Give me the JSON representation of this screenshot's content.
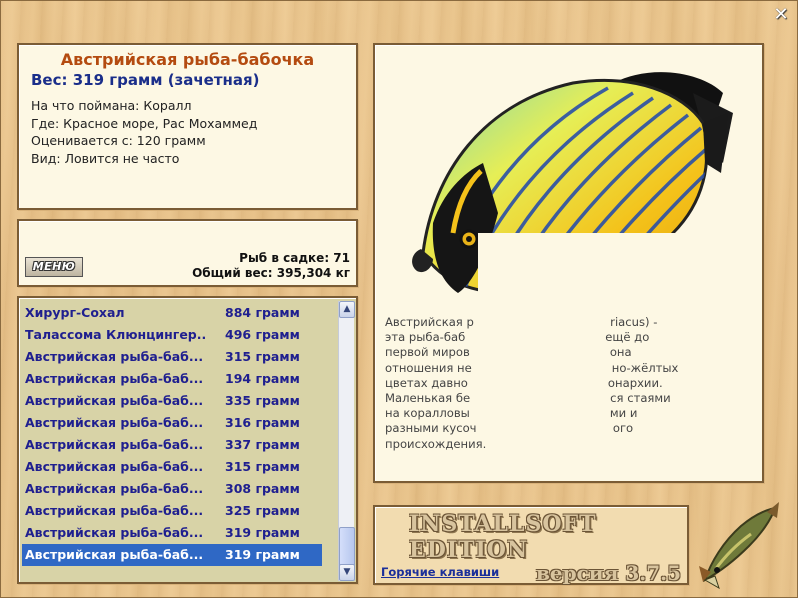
{
  "window": {
    "close_glyph": "✕"
  },
  "info": {
    "fish_name": "Австрийская рыба-бабочка",
    "weight": "Вес: 319 грамм (зачетная)",
    "caught_on_label": "На что поймана:",
    "caught_on": "Коралл",
    "location_label": "Где:",
    "location": "Красное море, Рас Мохаммед",
    "rated_from_label": "Оценивается с:",
    "rated_from": "120 грамм",
    "species_label": "Вид:",
    "species": "Ловится не часто"
  },
  "stats": {
    "menu_button": "МЕНЮ",
    "fish_in_cage": "Рыб в садке: 71",
    "total_weight": "Общий вес: 395,304 кг"
  },
  "catch_list": [
    {
      "name": "Хирург-Сохал",
      "weight": "884 грамм"
    },
    {
      "name": "Талассома Клюнцингер...",
      "weight": "496 грамм"
    },
    {
      "name": "Австрийская рыба-баб...",
      "weight": "315 грамм"
    },
    {
      "name": "Австрийская рыба-баб...",
      "weight": "194 грамм"
    },
    {
      "name": "Австрийская рыба-баб...",
      "weight": "335 грамм"
    },
    {
      "name": "Австрийская рыба-баб...",
      "weight": "316 грамм"
    },
    {
      "name": "Австрийская рыба-баб...",
      "weight": "337 грамм"
    },
    {
      "name": "Австрийская рыба-баб...",
      "weight": "315 грамм"
    },
    {
      "name": "Австрийская рыба-баб...",
      "weight": "308 грамм"
    },
    {
      "name": "Австрийская рыба-баб...",
      "weight": "325 грамм"
    },
    {
      "name": "Австрийская рыба-баб...",
      "weight": "319 грамм"
    },
    {
      "name": "Австрийская рыба-баб...",
      "weight": "319 грамм"
    }
  ],
  "selected_index": 11,
  "scroll": {
    "up": "▲",
    "down": "▼"
  },
  "description": [
    "Австрийская р                                     riacus) -",
    "эта рыба-баб                                      ещё до",
    "первой миров                                      она",
    "отношения не                                      но-жёлтых",
    "цветах давно                                      онархии.",
    "Маленькая бе                                      ся стаями",
    "на коралловы                                      ми и",
    "разными кусоч                                     ого",
    "происхождения."
  ],
  "footer": {
    "edition": "INSTALLSOFT EDITION",
    "hotkeys": "Горячие клавиши",
    "version": "версия 3.7.5"
  },
  "colors": {
    "title": "#b44b10",
    "weight": "#1a2e8a",
    "list_text": "#1f1f8f",
    "selection": "#2f68c5"
  }
}
